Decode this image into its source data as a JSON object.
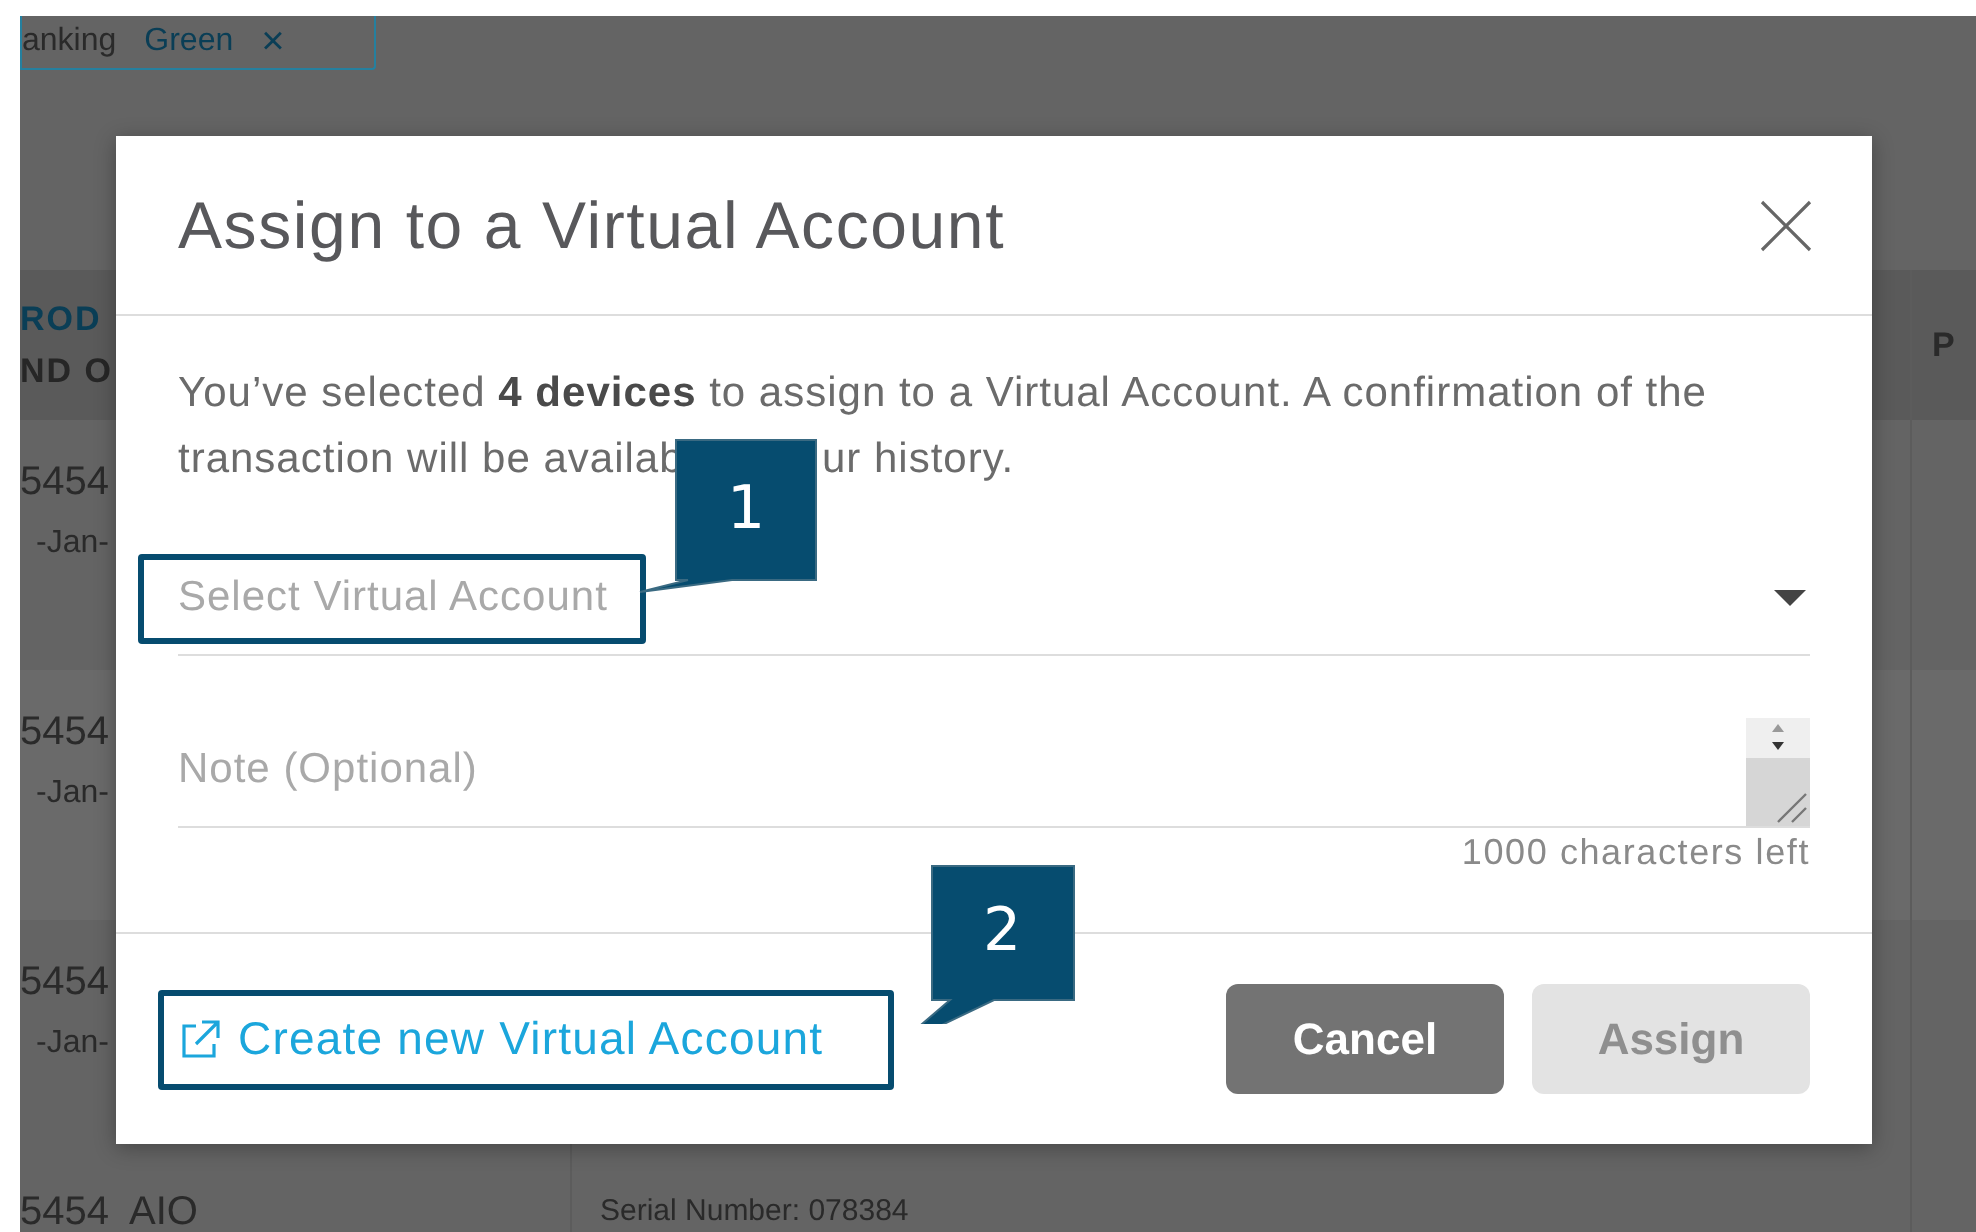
{
  "background": {
    "filter_chip": {
      "label": "anking",
      "value": "Green",
      "remove": "×"
    },
    "header": {
      "line_1": "ROD",
      "line_2": "ND O",
      "last_column": "P"
    },
    "rows": [
      {
        "cell_1": "5454",
        "cell_2": "-Jan-"
      },
      {
        "cell_1": "5454",
        "cell_2": "-Jan-"
      },
      {
        "cell_1": "5454",
        "cell_2": "-Jan-"
      }
    ],
    "last_row": {
      "cell_1": "5454  AIO",
      "cell_2": "Serial Number: 078384"
    }
  },
  "dialog": {
    "title": "Assign to a Virtual Account",
    "message": {
      "line_1": "You’ve selected **4 devices** to assign to a Virtual Account. A confirmation of the",
      "line_2_start": "transaction will be availab",
      "line_2_end": "ur history."
    },
    "account_select": {
      "placeholder": "Select Virtual Account"
    },
    "note": {
      "placeholder": "Note (Optional)",
      "counter": "1000 characters left"
    },
    "create_link": "Create new Virtual Account",
    "buttons": [
      {
        "label": "Cancel",
        "disabled": false
      },
      {
        "label": "Assign",
        "disabled": true
      }
    ]
  },
  "callouts": [
    {
      "number": "1"
    },
    {
      "number": "2"
    }
  ]
}
